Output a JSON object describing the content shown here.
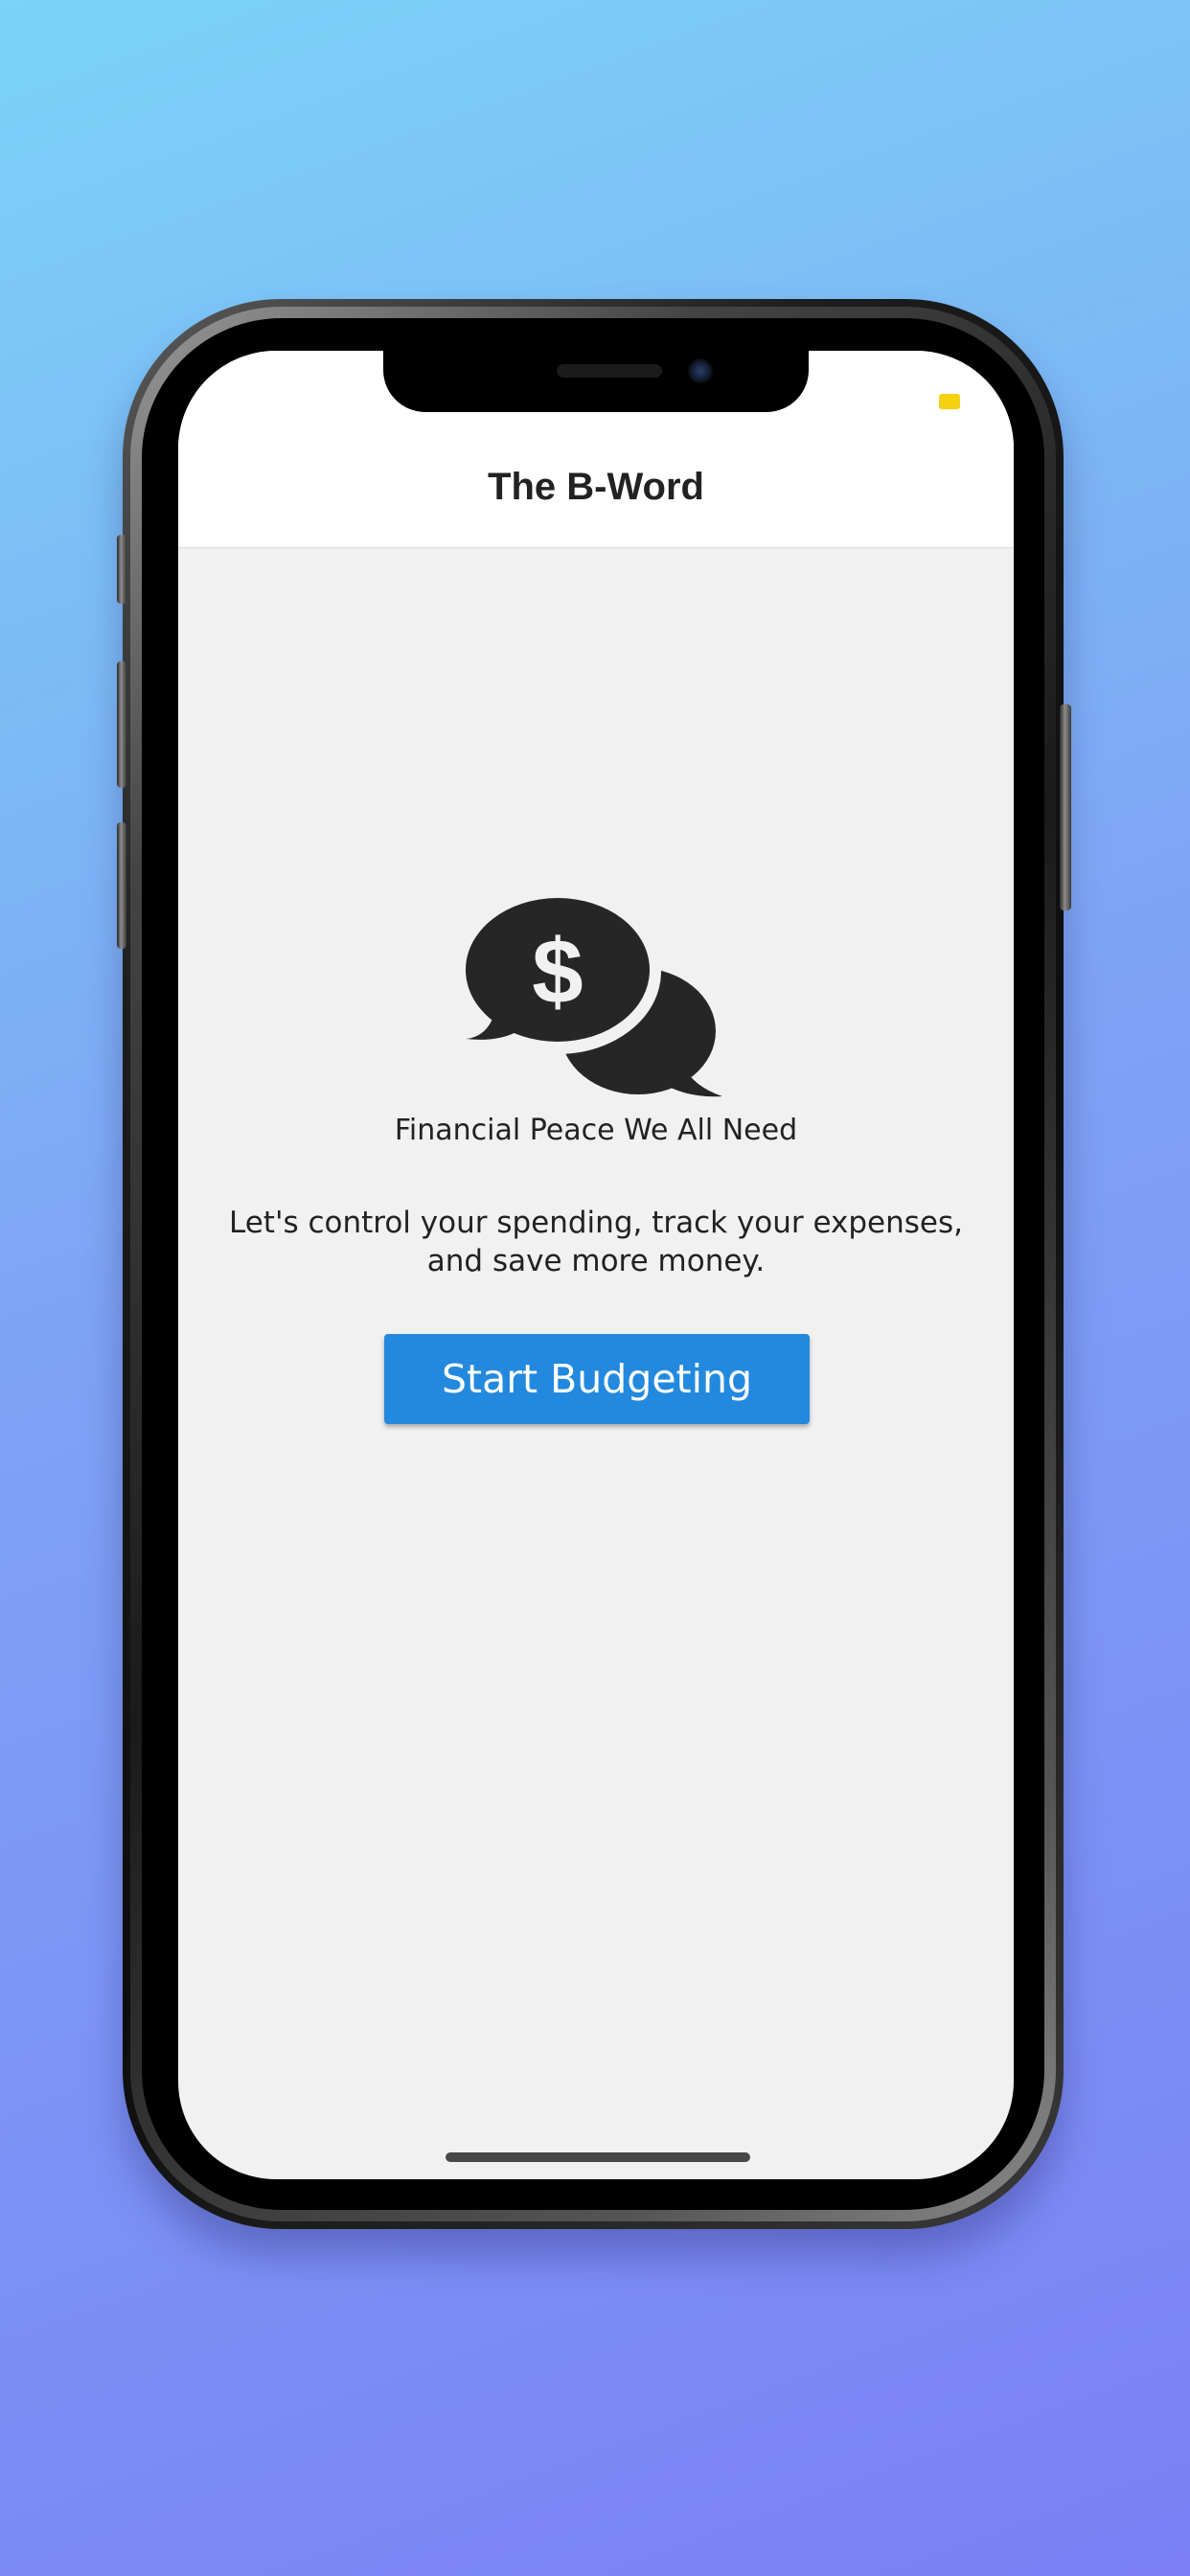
{
  "app": {
    "title": "The B-Word"
  },
  "hero": {
    "icon": "chat-bubbles-dollar-icon",
    "icon_symbol": "$",
    "tagline": "Financial Peace We All Need",
    "description": "Let's control your spending, track your expenses, and save more money."
  },
  "actions": {
    "start_label": "Start Budgeting"
  },
  "colors": {
    "background_top": "#7bd3f7",
    "background_bottom": "#7b80f6",
    "screen_background": "#f1f1f1",
    "header_background": "#ffffff",
    "primary_button": "#2389de",
    "text": "#222222",
    "icon": "#262626",
    "battery": "#f5d10f"
  }
}
